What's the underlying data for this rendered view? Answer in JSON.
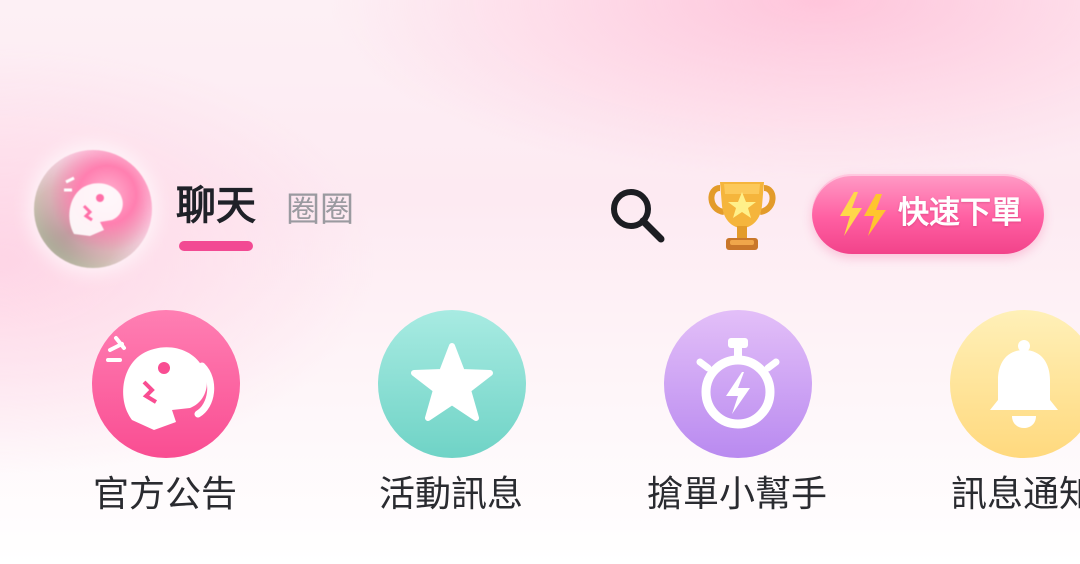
{
  "header": {
    "tabs": [
      {
        "label": "聊天",
        "active": true
      },
      {
        "label": "圈圈",
        "active": false
      }
    ],
    "icons": {
      "search": "search-icon",
      "trophy": "trophy-icon",
      "avatar": "mascot-avatar"
    },
    "quick_order_label": "快速下單"
  },
  "shortcuts": [
    {
      "label": "官方公告",
      "icon": "dinosaur-mascot-icon",
      "color": "#f94d92"
    },
    {
      "label": "活動訊息",
      "icon": "star-icon",
      "color": "#6fd3c6"
    },
    {
      "label": "搶單小幫手",
      "icon": "stopwatch-bolt-icon",
      "color": "#b98af0"
    },
    {
      "label": "訊息通知",
      "icon": "bell-icon",
      "color": "#ffd97e"
    }
  ],
  "colors": {
    "accent": "#f24a93",
    "text_primary": "#1f2128",
    "text_secondary": "#9a9aa0"
  }
}
